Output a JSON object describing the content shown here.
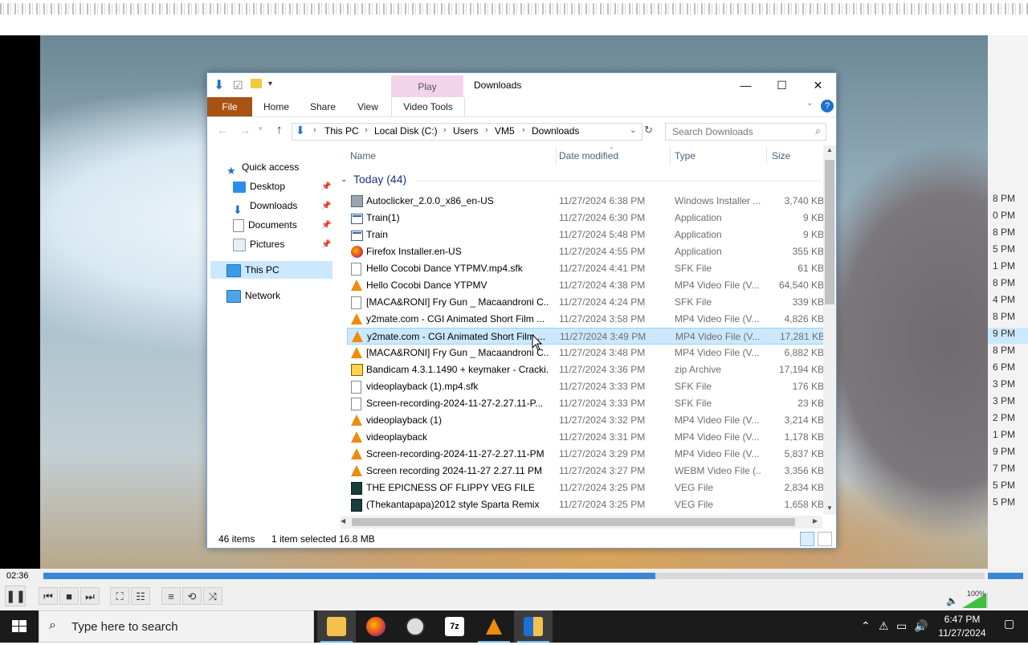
{
  "player": {
    "time": "02:36",
    "progress": 0.65,
    "volume": "100%"
  },
  "background_list": {
    "times": [
      "8 PM",
      "0 PM",
      "8 PM",
      "5 PM",
      "1 PM",
      "8 PM",
      "4 PM",
      "8 PM",
      "9 PM",
      "8 PM",
      "6 PM",
      "3 PM",
      "3 PM",
      "2 PM",
      "1 PM",
      "9 PM",
      "7 PM",
      "5 PM",
      "5 PM"
    ]
  },
  "explorer": {
    "title": "Downloads",
    "play_tab": "Play",
    "ribbon_tabs": [
      "File",
      "Home",
      "Share",
      "View",
      "Video Tools"
    ],
    "breadcrumb": [
      "This PC",
      "Local Disk (C:)",
      "Users",
      "VM5",
      "Downloads"
    ],
    "search_placeholder": "Search Downloads",
    "nav": {
      "quick_access": "Quick access",
      "items": [
        "Desktop",
        "Downloads",
        "Documents",
        "Pictures"
      ],
      "this_pc": "This PC",
      "network": "Network"
    },
    "columns": [
      "Name",
      "Date modified",
      "Type",
      "Size"
    ],
    "group": "Today (44)",
    "files": [
      {
        "name": "Autoclicker_2.0.0_x86_en-US",
        "date": "11/27/2024 6:38 PM",
        "type": "Windows Installer ...",
        "size": "3,740 KB",
        "icon": "msi"
      },
      {
        "name": "Train(1)",
        "date": "11/27/2024 6:30 PM",
        "type": "Application",
        "size": "9 KB",
        "icon": "app"
      },
      {
        "name": "Train",
        "date": "11/27/2024 5:48 PM",
        "type": "Application",
        "size": "9 KB",
        "icon": "app"
      },
      {
        "name": "Firefox Installer.en-US",
        "date": "11/27/2024 4:55 PM",
        "type": "Application",
        "size": "355 KB",
        "icon": "firefox"
      },
      {
        "name": "Hello Cocobi Dance YTPMV.mp4.sfk",
        "date": "11/27/2024 4:41 PM",
        "type": "SFK File",
        "size": "61 KB",
        "icon": "doc"
      },
      {
        "name": "Hello Cocobi Dance YTPMV",
        "date": "11/27/2024 4:38 PM",
        "type": "MP4 Video File (V...",
        "size": "64,540 KB",
        "icon": "vlc"
      },
      {
        "name": "[MACA&RONI] Fry Gun _ Macaandroni C...",
        "date": "11/27/2024 4:24 PM",
        "type": "SFK File",
        "size": "339 KB",
        "icon": "doc"
      },
      {
        "name": "y2mate.com - CGI Animated Short Film ...",
        "date": "11/27/2024 3:58 PM",
        "type": "MP4 Video File (V...",
        "size": "4,826 KB",
        "icon": "vlc"
      },
      {
        "name": "y2mate.com - CGI Animated Short Film ...",
        "date": "11/27/2024 3:49 PM",
        "type": "MP4 Video File (V...",
        "size": "17,281 KB",
        "icon": "vlc",
        "selected": true
      },
      {
        "name": "[MACA&RONI] Fry Gun _ Macaandroni C...",
        "date": "11/27/2024 3:48 PM",
        "type": "MP4 Video File (V...",
        "size": "6,882 KB",
        "icon": "vlc"
      },
      {
        "name": "Bandicam 4.3.1.1490 + keymaker - Cracki...",
        "date": "11/27/2024 3:36 PM",
        "type": "zip Archive",
        "size": "17,194 KB",
        "icon": "zip"
      },
      {
        "name": "videoplayback (1).mp4.sfk",
        "date": "11/27/2024 3:33 PM",
        "type": "SFK File",
        "size": "176 KB",
        "icon": "doc"
      },
      {
        "name": "Screen-recording-2024-11-27-2.27.11-P...",
        "date": "11/27/2024 3:33 PM",
        "type": "SFK File",
        "size": "23 KB",
        "icon": "doc"
      },
      {
        "name": "videoplayback (1)",
        "date": "11/27/2024 3:32 PM",
        "type": "MP4 Video File (V...",
        "size": "3,214 KB",
        "icon": "vlc"
      },
      {
        "name": "videoplayback",
        "date": "11/27/2024 3:31 PM",
        "type": "MP4 Video File (V...",
        "size": "1,178 KB",
        "icon": "vlc"
      },
      {
        "name": "Screen-recording-2024-11-27-2.27.11-PM",
        "date": "11/27/2024 3:29 PM",
        "type": "MP4 Video File (V...",
        "size": "5,837 KB",
        "icon": "vlc"
      },
      {
        "name": "Screen recording 2024-11-27 2.27.11 PM",
        "date": "11/27/2024 3:27 PM",
        "type": "WEBM Video File (...",
        "size": "3,356 KB",
        "icon": "vlc"
      },
      {
        "name": "THE EPICNESS OF FLIPPY VEG FILE",
        "date": "11/27/2024 3:25 PM",
        "type": "VEG File",
        "size": "2,834 KB",
        "icon": "veg"
      },
      {
        "name": "(Thekantapapa)2012 style Sparta Remix",
        "date": "11/27/2024 3:25 PM",
        "type": "VEG File",
        "size": "1,658 KB",
        "icon": "veg"
      }
    ],
    "status": {
      "items": "46 items",
      "selected": "1 item selected",
      "size": "16.8 MB"
    }
  },
  "taskbar": {
    "search_placeholder": "Type here to search",
    "time": "6:47 PM",
    "date": "11/27/2024"
  }
}
